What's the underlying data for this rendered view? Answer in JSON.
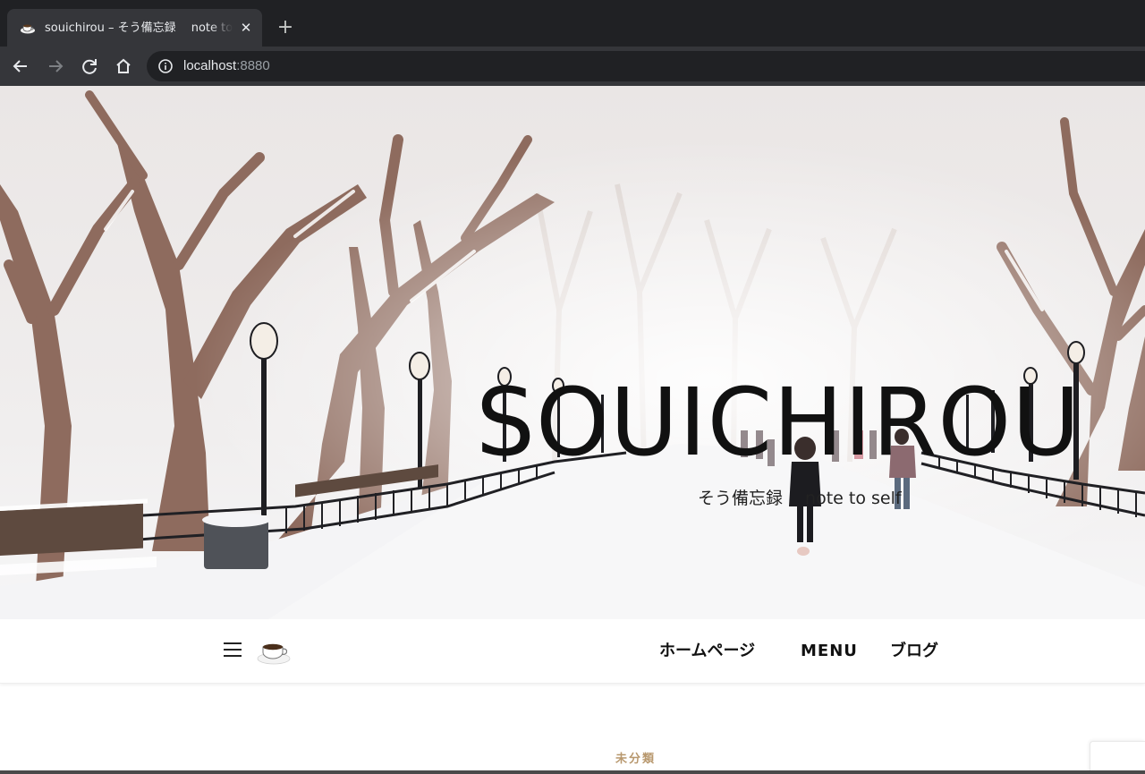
{
  "browser": {
    "tab": {
      "title": "souichirou – そう備忘録　 note to self",
      "favicon": "coffee-cup-icon",
      "close_label": "✕"
    },
    "new_tab_label": "+",
    "url_host": "localhost",
    "url_port": ":8880"
  },
  "hero": {
    "site_title": "SOUICHIROU",
    "tagline": "そう備忘録　 note to self"
  },
  "nav": {
    "menu_icon": "hamburger-icon",
    "logo_icon": "coffee-cup-icon",
    "items": [
      {
        "label": "ホームページ"
      },
      {
        "label": "MENU"
      },
      {
        "label": "ブログ"
      }
    ]
  },
  "content": {
    "category": "未分類"
  },
  "colors": {
    "chrome_dark": "#202124",
    "chrome_mid": "#35363a",
    "category_accent": "#b8986e"
  }
}
